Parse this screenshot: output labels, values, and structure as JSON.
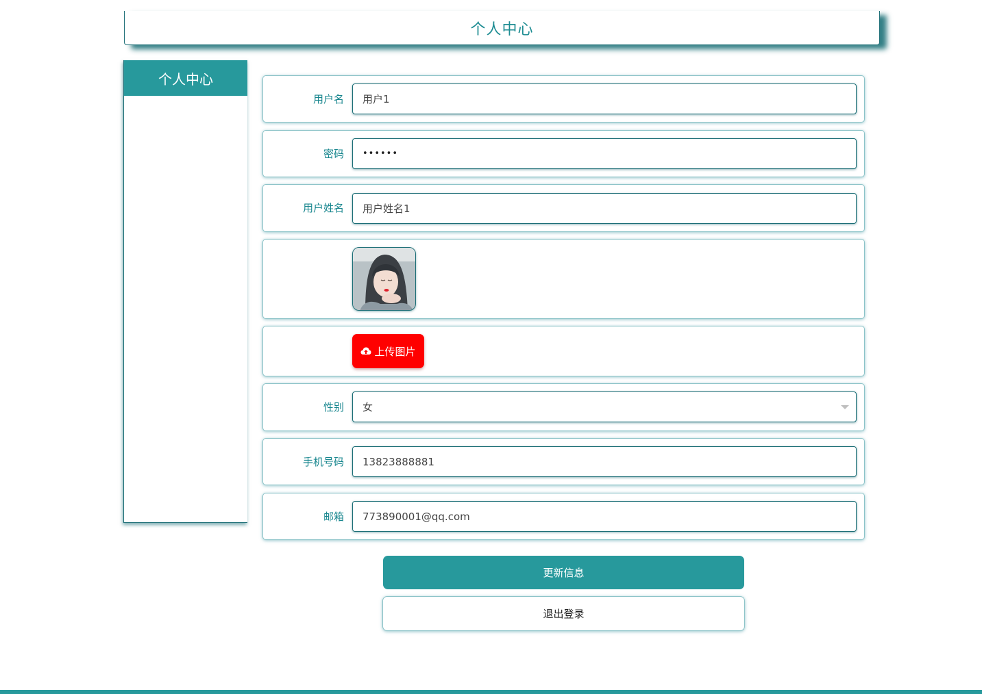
{
  "header": {
    "title": "个人中心"
  },
  "sidebar": {
    "title": "个人中心"
  },
  "form": {
    "username": {
      "label": "用户名",
      "value": "用户1"
    },
    "password": {
      "label": "密码",
      "value": "••••••"
    },
    "fullname": {
      "label": "用户姓名",
      "value": "用户姓名1"
    },
    "upload": {
      "label": "上传图片"
    },
    "gender": {
      "label": "性别",
      "value": "女"
    },
    "phone": {
      "label": "手机号码",
      "value": "13823888881"
    },
    "email": {
      "label": "邮箱",
      "value": "773890001@qq.com"
    }
  },
  "actions": {
    "update_label": "更新信息",
    "logout_label": "退出登录"
  },
  "colors": {
    "accent": "#27999c",
    "upload": "#ff0000",
    "label": "#16858d"
  }
}
